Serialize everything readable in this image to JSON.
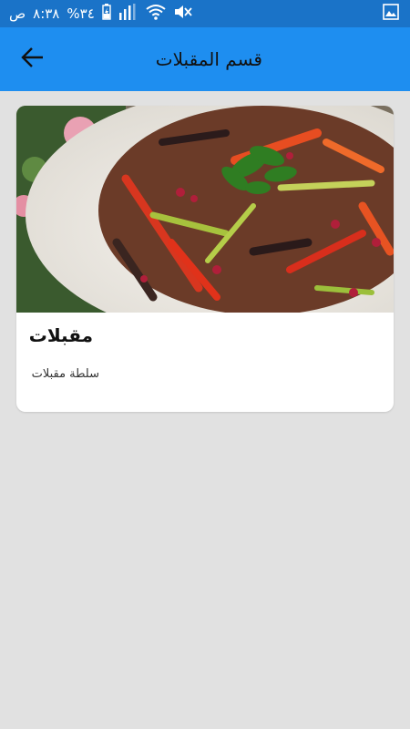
{
  "status_bar": {
    "time": "٨:٣٨",
    "am_pm": "ص",
    "battery_percent": "%٣٤",
    "icons": [
      "gallery-icon",
      "mute-icon",
      "wifi-icon",
      "signal-icon",
      "battery-charging-icon"
    ]
  },
  "app_bar": {
    "title": "قسم المقبلات",
    "back_icon": "arrow-back-icon"
  },
  "card": {
    "title": "مقبلات",
    "subtitle": "سلطة مقبلات",
    "image": "salad-photo"
  },
  "colors": {
    "status_bar": "#1a73c8",
    "app_bar": "#1e8ef0",
    "background": "#e1e1e1",
    "card": "#ffffff"
  }
}
